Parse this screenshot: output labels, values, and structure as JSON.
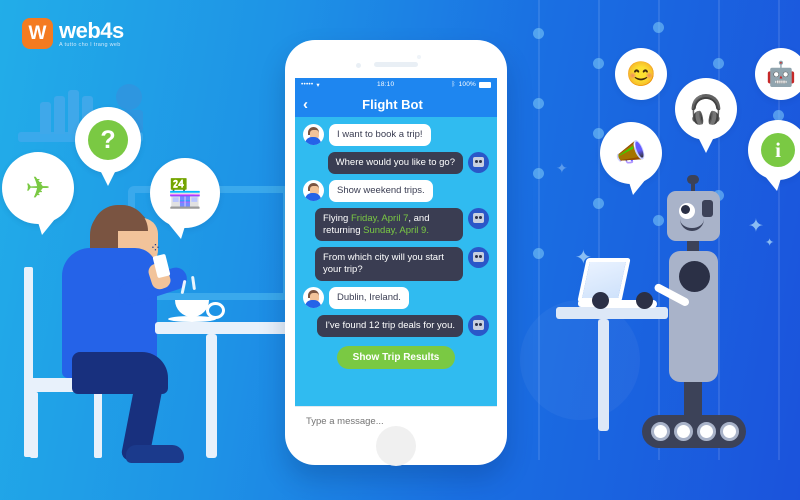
{
  "brand": {
    "mark": "W",
    "name": "web4s",
    "tagline": "A tutto cho I trang web"
  },
  "colors": {
    "bg_gradient_start": "#22ADE8",
    "bg_gradient_end": "#1B53DC",
    "accent_green": "#7AC943",
    "bot_bubble": "#3A3D52",
    "nav_blue": "#1E86F0",
    "screen_blue": "#30BBF0",
    "brand_orange": "#F47B20",
    "robot_body": "#A9B3C9"
  },
  "phone": {
    "status": {
      "signal": "•••••",
      "wifi": "wifi-icon",
      "time": "18:10",
      "bluetooth": "bluetooth-icon",
      "battery": "100%"
    },
    "nav": {
      "back": "‹",
      "title": "Flight Bot"
    },
    "messages": [
      {
        "from": "user",
        "text": "I want to book a trip!"
      },
      {
        "from": "bot",
        "text": "Where would you like to go?"
      },
      {
        "from": "user",
        "text": "Show weekend trips."
      },
      {
        "from": "bot",
        "prefix": "Flying ",
        "hl1": "Friday, April 7",
        "mid": ", and returning ",
        "hl2": "Sunday, April 9."
      },
      {
        "from": "bot",
        "text": "From which city will you start your trip?"
      },
      {
        "from": "user",
        "text": "Dublin, Ireland."
      },
      {
        "from": "bot",
        "text": "I've found 12 trip deals for you."
      }
    ],
    "cta": "Show Trip Results",
    "input_placeholder": "Type a message...",
    "input_value": ""
  },
  "left_bubbles": [
    {
      "icon": "airplane-icon",
      "glyph": "✈"
    },
    {
      "icon": "question-mark-icon",
      "glyph": "?"
    },
    {
      "icon": "storefront-icon",
      "glyph": "🏪"
    }
  ],
  "right_bubbles": [
    {
      "icon": "smiley-face-icon",
      "glyph": "😊"
    },
    {
      "icon": "robot-face-icon",
      "glyph": "🤖"
    },
    {
      "icon": "headset-support-icon",
      "glyph": "🎧"
    },
    {
      "icon": "megaphone-icon",
      "glyph": "📣"
    },
    {
      "icon": "info-icon",
      "glyph": "i"
    }
  ],
  "scene": {
    "person": "person-using-phone",
    "robot": "chatbot-robot-character",
    "laptop": "laptop-on-desk",
    "coffee": "coffee-cup"
  }
}
